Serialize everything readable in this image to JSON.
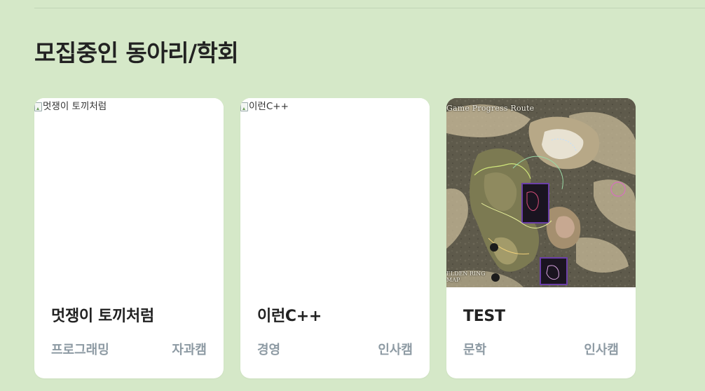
{
  "section": {
    "title": "모집중인 동아리/학회"
  },
  "clubs": [
    {
      "name": "멋쟁이 토끼처럼",
      "image_alt": "멋쟁이 토끼처럼",
      "image_state": "broken",
      "category": "프로그래밍",
      "campus": "자과캠"
    },
    {
      "name": "이런C++",
      "image_alt": "이런C++",
      "image_state": "broken",
      "category": "경영",
      "campus": "인사캠"
    },
    {
      "name": "TEST",
      "image_state": "map",
      "image_caption": "Game Progress Route",
      "image_legend": "ELDEN RING\nMAP",
      "category": "문학",
      "campus": "인사캠"
    }
  ],
  "colors": {
    "background": "#d5e8c8",
    "card": "#ffffff",
    "meta_text": "#8d9aa3",
    "title_text": "#222222"
  },
  "icons": {
    "broken_image": "broken-image-icon"
  }
}
